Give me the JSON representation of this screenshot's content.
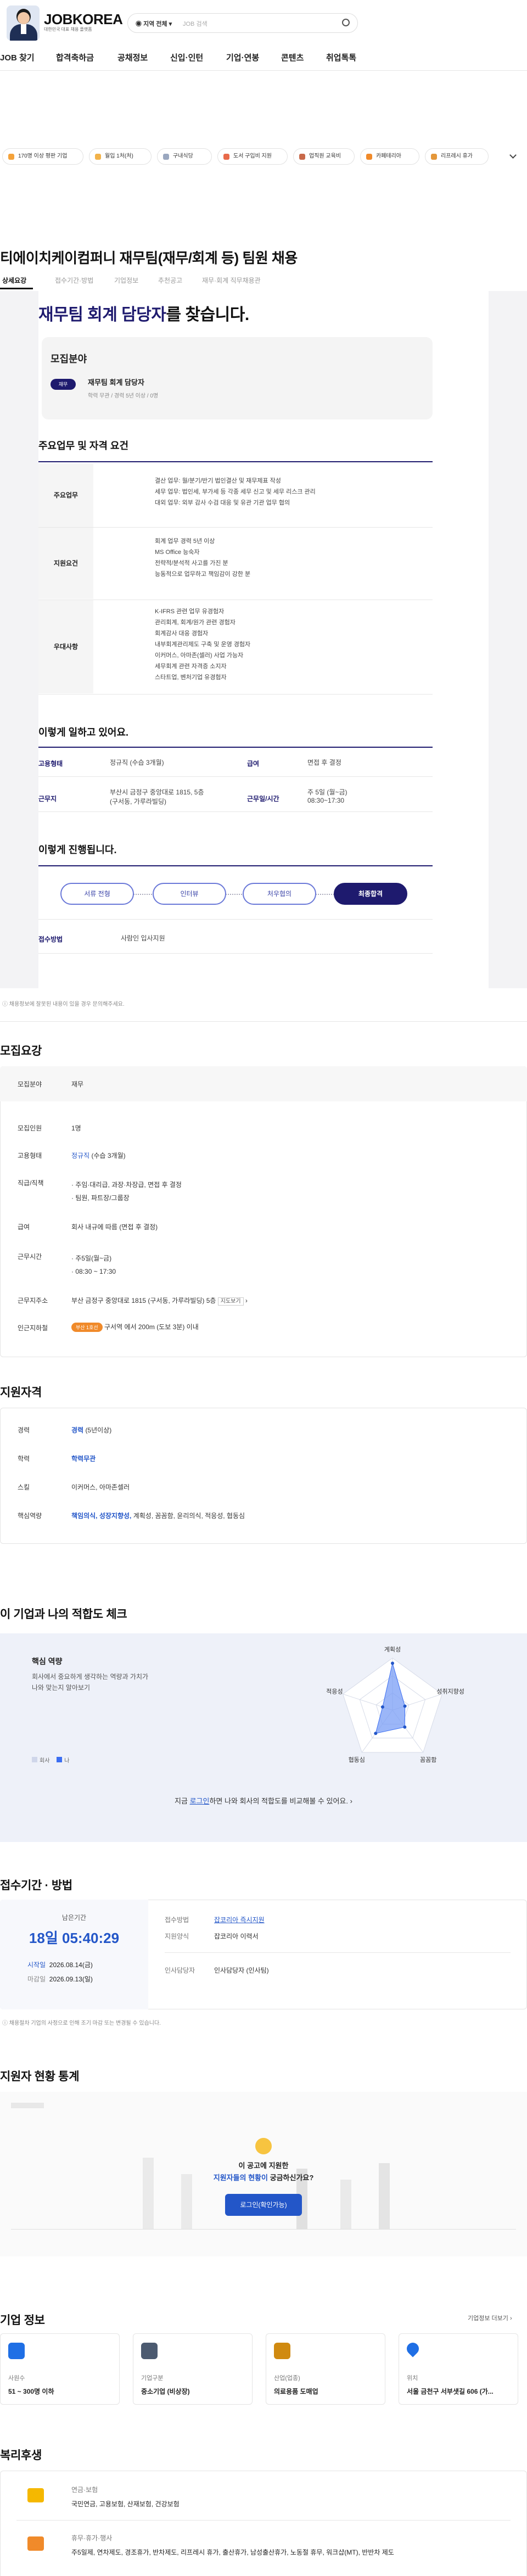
{
  "header": {
    "logo": "JOBKOREA",
    "logo_sub": "대한민국 대표 채용 플랫폼",
    "search_location": "지역 전체",
    "search_placeholder": "JOB 검색",
    "nav": [
      "JOB 찾기",
      "합격축하금",
      "공채정보",
      "신입·인턴",
      "기업·연봉",
      "콘텐츠",
      "취업톡톡"
    ]
  },
  "chips": [
    "170명 이상 평판 기업",
    "월입 1처(처)",
    "구내식당",
    "도서 구입비 지원",
    "업직원 교육비",
    "카페테리아",
    "리프레시 휴가"
  ],
  "title": "티에이치케이컴퍼니 재무팀(재무/회계 등) 팀원 채용",
  "tabs": [
    "상세요강",
    "접수기간·방법",
    "기업정보",
    "추천공고",
    "재무·회계 직무채용관"
  ],
  "poster": {
    "headline_pre": "재무팀 회계 담당자",
    "headline_post": "를 찾습니다.",
    "recruit_title": "모집분야",
    "recruit_pill": "재무",
    "recruit_role": "재무팀 회계 담당자",
    "recruit_sub": "학력 무관 / 경력 5년 이상 / 0명",
    "duties_title": "주요업무 및 자격 요건",
    "rows": [
      {
        "label": "주요업무",
        "lines": [
          "결산 업무: 월/분기/반기 법인결산 및 재무제표 작성",
          "세무 업무: 법인세, 부가세 등 각종 세무 신고 및 세무 리스크 관리",
          "대외 업무: 외부 감사 수검 대응 및 유관 기관 업무 협의"
        ]
      },
      {
        "label": "지원요건",
        "lines": [
          "회계 업무 경력 5년 이상",
          "MS Office 능숙자",
          "전략적/분석적 사고를 가진 분",
          "능동적으로 업무하고 책임감이 강한 분"
        ]
      },
      {
        "label": "우대사항",
        "lines": [
          "K-IFRS 관련 업무 유경험자",
          "관리회계, 회계/원가 관련 경험자",
          "회계감사 대응 경험자",
          "내부회계관리제도 구축 및 운영 경험자",
          "이커머스, 아마존(셀러) 사업 가능자",
          "세무회계 관련 자격증 소지자",
          "스타트업, 벤처기업 유경험자"
        ]
      }
    ],
    "work_title": "이렇게 일하고 있어요.",
    "work": [
      {
        "k": "고용형태",
        "v": "정규직 (수습 3개월)"
      },
      {
        "k": "급여",
        "v": "면접 후 결정"
      },
      {
        "k": "근무지",
        "v": "부산시 금정구 중앙대로 1815, 5층",
        "v2": "(구서동, 가루라빌딩)"
      },
      {
        "k": "근무일/시간",
        "v": "주 5일 (월~금)",
        "v2": "08:30~17:30"
      }
    ],
    "process_title": "이렇게 진행됩니다.",
    "process": [
      "서류 전형",
      "인터뷰",
      "처우협의",
      "최종합격"
    ],
    "apply_k": "접수방법",
    "apply_v": "사람인 입사지원",
    "notice": "채용정보에 잘못된 내용이 있을 경우 문의해주세요."
  },
  "requirements": {
    "heading": "모집요강",
    "field_label": "모집분야",
    "field_value": "재무",
    "count_label": "모집인원",
    "count_value": "1명",
    "type_label": "고용형태",
    "type_value": "정규직",
    "type_extra": "(수습 3개월)",
    "pay_label": "직급/직책",
    "pay_lines": [
      "주임·대리급, 과장·차장급, 면접 후 결정",
      "팀원, 파트장/그룹장"
    ],
    "salary_label": "급여",
    "salary_value": "회사 내규에 따름 (면접 후 결정)",
    "hours_label": "근무시간",
    "hours_lines": [
      "주5일(월~금)",
      "08:30 ~ 17:30"
    ],
    "loc_label": "근무지주소",
    "loc_value": "부산 금정구 중앙대로 1815 (구서동, 가루라빌딩) 5층",
    "loc_link": "지도보기",
    "near_label": "인근지하철",
    "near_tag": "부산 1호선",
    "near_value": "구서역 에서 200m (도보 3분) 이내"
  },
  "qualifications": {
    "heading": "지원자격",
    "exp_label": "경력",
    "exp_value": "경력",
    "exp_extra": "(5년이상)",
    "edu_label": "학력",
    "edu_value": "학력무관",
    "skill_label": "스킬",
    "skill_value": "이커머스, 아마존셀러",
    "core_label": "핵심역량",
    "core_value": "책임의식, 성장지향성,",
    "core_extra": "계획성, 꼼꼼함, 윤리의식, 적응성, 협동심"
  },
  "fit": {
    "heading": "이 기업과 나의 적합도 체크",
    "title": "핵심 역량",
    "desc1": "회사에서 중요하게 생각하는 역량과 가치가",
    "desc2": "나와 맞는지 알아보기",
    "legend_company": "회사",
    "legend_me": "나",
    "axes": [
      "계획성",
      "성취지향성",
      "꼼꼼함",
      "협동심",
      "적응성"
    ],
    "company_values": [
      0.9,
      0.25,
      0.4,
      0.55,
      0.2
    ],
    "bottom_pre": "지금",
    "bottom_link": "로그인",
    "bottom_post": "하면 나와 회사의 적합도를 비교해볼 수 있어요."
  },
  "apply": {
    "heading": "접수기간 · 방법",
    "remain_label": "남은기간",
    "remain_value": "18일 05:40:29",
    "start_label": "시작일",
    "start_value": "2026.08.14(금)",
    "end_label": "마감일",
    "end_value": "2026.09.13(일)",
    "method_label": "접수방법",
    "method_value": "잡코리아 즉시지원",
    "form_label": "지원양식",
    "form_value": "잡코리아 이력서",
    "hr_label": "인사담당자",
    "hr_value": "인사담당자 (인사팀)",
    "notice": "채용절차 기업의 사정으로 인해 조기 마감 또는 변경될 수 있습니다."
  },
  "stats": {
    "heading": "지원자 현황 통계",
    "q1": "이 공고에 지원한",
    "q2_link": "지원자들의 현황이",
    "q2_post": "궁금하신가요?",
    "button": "로그인(확인가능)"
  },
  "company": {
    "heading": "기업 정보",
    "more": "기업정보 더보기",
    "cards": [
      {
        "label": "사원수",
        "value": "51 ~ 300명 이하",
        "color": "#1f6fe5"
      },
      {
        "label": "기업구분",
        "value": "중소기업 (비상장)",
        "color": "#4c5a70"
      },
      {
        "label": "산업(업종)",
        "value": "의료용품 도매업",
        "color": "#d08a10"
      },
      {
        "label": "위치",
        "value": "서울 금천구 서부샛길 606 (가...",
        "color": "#1f6fe5"
      }
    ]
  },
  "welfare": {
    "heading": "복리후생",
    "items": [
      {
        "title": "연금·보험",
        "text": "국민연금, 고용보험, 산재보험, 건강보험"
      },
      {
        "title": "휴무·휴가·행사",
        "text": "주5일제, 연차제도, 경조휴가, 반차제도, 리프레시 휴가, 출산휴가, 남성출산휴가, 노동절 휴무, 워크샵(MT), 반반차 제도"
      }
    ]
  }
}
